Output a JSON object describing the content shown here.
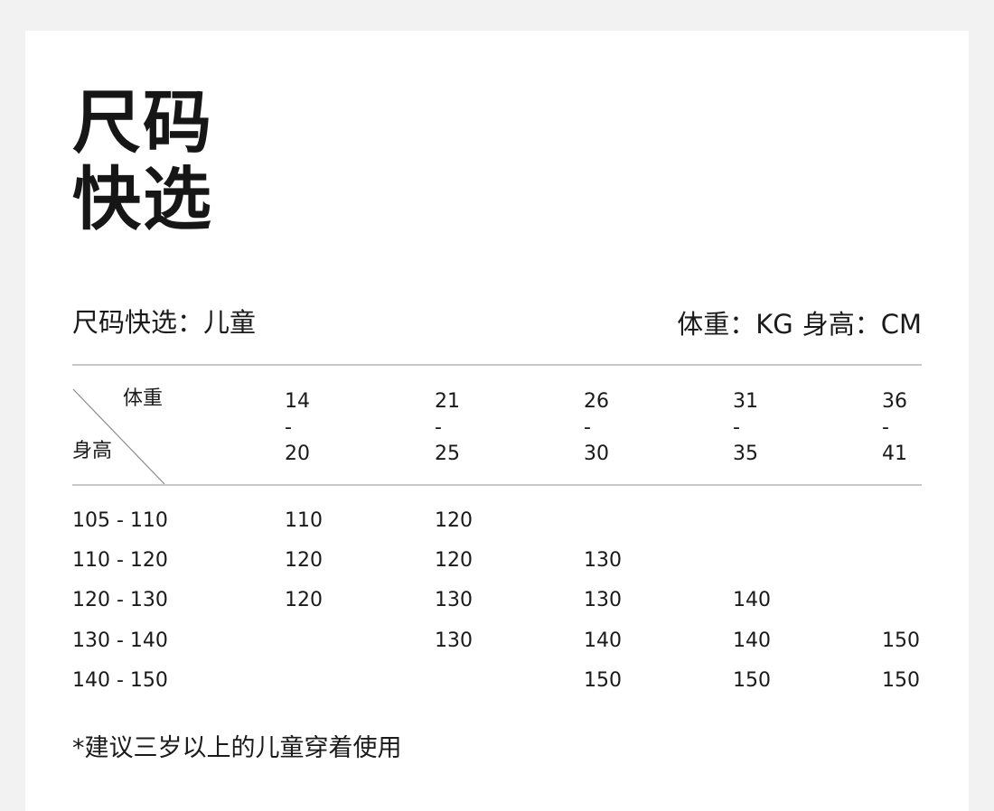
{
  "title": {
    "line1": "尺码",
    "line2": "快选"
  },
  "subheader": {
    "left": "尺码快选：儿童",
    "right_weight": "体重：KG",
    "right_height": "身高：CM"
  },
  "table": {
    "corner_weight_label": "体重",
    "corner_height_label": "身高",
    "weight_columns": [
      {
        "from": "14",
        "dash": "-",
        "to": "20"
      },
      {
        "from": "21",
        "dash": "-",
        "to": "25"
      },
      {
        "from": "26",
        "dash": "-",
        "to": "30"
      },
      {
        "from": "31",
        "dash": "-",
        "to": "35"
      },
      {
        "from": "36",
        "dash": "-",
        "to": "41"
      }
    ],
    "rows": [
      {
        "height": "105 - 110",
        "cells": [
          "110",
          "120",
          "",
          "",
          ""
        ]
      },
      {
        "height": "110 - 120",
        "cells": [
          "120",
          "120",
          "130",
          "",
          ""
        ]
      },
      {
        "height": "120 - 130",
        "cells": [
          "120",
          "130",
          "130",
          "140",
          ""
        ]
      },
      {
        "height": "130 - 140",
        "cells": [
          "",
          "130",
          "140",
          "140",
          "150"
        ]
      },
      {
        "height": "140 - 150",
        "cells": [
          "",
          "",
          "150",
          "150",
          "150"
        ]
      }
    ]
  },
  "footnote": "*建议三岁以上的儿童穿着使用"
}
